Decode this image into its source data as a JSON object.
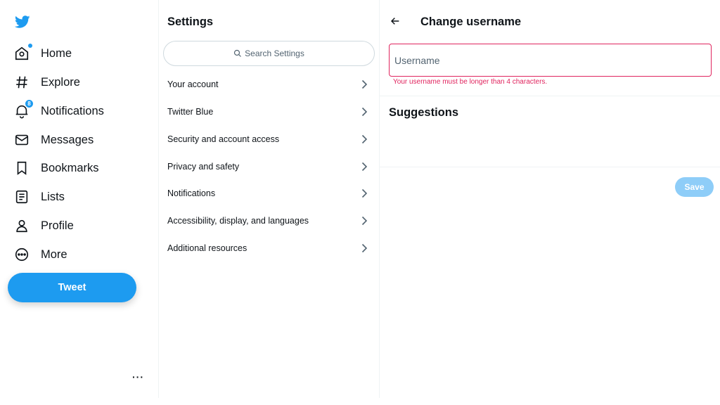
{
  "nav": {
    "logo": "twitter-bird-icon",
    "items": [
      {
        "label": "Home",
        "icon": "home-icon"
      },
      {
        "label": "Explore",
        "icon": "hashtag-icon"
      },
      {
        "label": "Notifications",
        "icon": "bell-icon",
        "badge": "8"
      },
      {
        "label": "Messages",
        "icon": "envelope-icon"
      },
      {
        "label": "Bookmarks",
        "icon": "bookmark-icon"
      },
      {
        "label": "Lists",
        "icon": "list-icon"
      },
      {
        "label": "Profile",
        "icon": "person-icon"
      },
      {
        "label": "More",
        "icon": "more-circle-icon"
      }
    ],
    "tweet_label": "Tweet",
    "account_more": "···"
  },
  "settings": {
    "title": "Settings",
    "search_placeholder": "Search Settings",
    "items": [
      {
        "label": "Your account"
      },
      {
        "label": "Twitter Blue"
      },
      {
        "label": "Security and account access"
      },
      {
        "label": "Privacy and safety"
      },
      {
        "label": "Notifications"
      },
      {
        "label": "Accessibility, display, and languages"
      },
      {
        "label": "Additional resources"
      }
    ]
  },
  "panel": {
    "title": "Change username",
    "username_value": "",
    "username_placeholder": "Username",
    "error": "Your username must be longer than 4 characters.",
    "suggestions_title": "Suggestions",
    "save_label": "Save"
  },
  "colors": {
    "accent": "#1d9bf0",
    "save_disabled": "#8ecdf8",
    "error": "#e0245e",
    "text": "#0f1419",
    "muted": "#536471"
  }
}
